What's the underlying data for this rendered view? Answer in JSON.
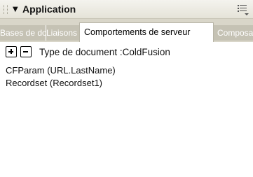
{
  "panel": {
    "title": "Application",
    "expander_glyph": "▼",
    "options_icon": "panel-options-icon"
  },
  "tabs": [
    {
      "label": "Bases de données",
      "active": false
    },
    {
      "label": "Liaisons",
      "active": false
    },
    {
      "label": "Comportements de serveur",
      "active": true
    },
    {
      "label": "Composants",
      "active": false
    }
  ],
  "toolbar": {
    "add_icon": "plus-icon",
    "remove_icon": "minus-icon",
    "document_type_label": "Type de document :ColdFusion"
  },
  "behaviors": [
    "CFParam (URL.LastName)",
    "Recordset (Recordset1)"
  ],
  "colors": {
    "titlebar": "#e9e7dd",
    "tabstrip": "#d9d6c9",
    "inactive_tab": "#c5c2b4",
    "background": "#ffffff"
  }
}
